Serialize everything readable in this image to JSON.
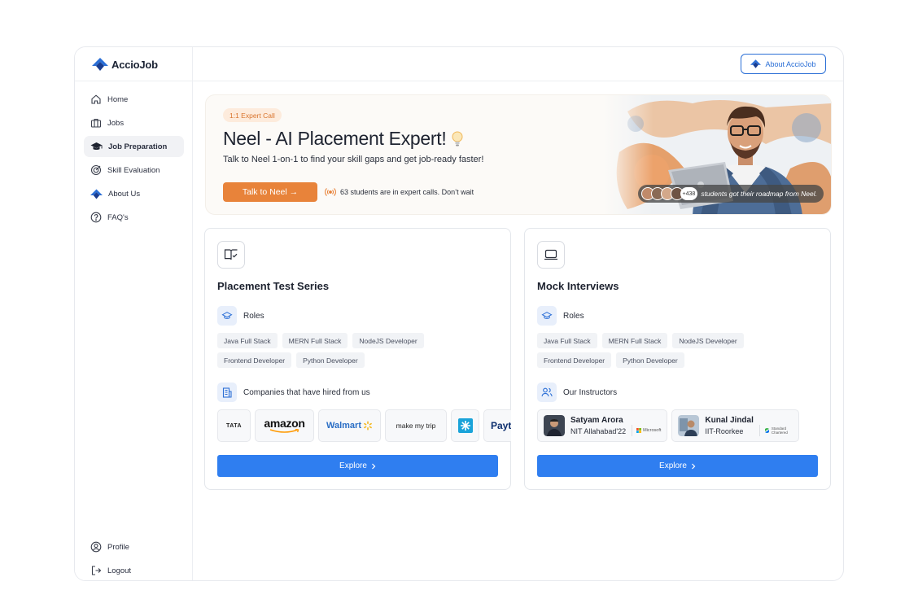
{
  "brand": {
    "name": "AccioJob",
    "color": "#2b6fd6"
  },
  "header": {
    "about_label": "About AccioJob"
  },
  "sidebar": {
    "items": [
      {
        "label": "Home",
        "icon": "home-icon"
      },
      {
        "label": "Jobs",
        "icon": "briefcase-icon"
      },
      {
        "label": "Job Preparation",
        "icon": "graduation-cap-icon",
        "active": true
      },
      {
        "label": "Skill Evaluation",
        "icon": "target-icon"
      },
      {
        "label": "About Us",
        "icon": "acciojob-logo-icon"
      },
      {
        "label": "FAQ's",
        "icon": "question-icon"
      }
    ],
    "bottom": [
      {
        "label": "Profile",
        "icon": "user-circle-icon"
      },
      {
        "label": "Logout",
        "icon": "logout-icon"
      }
    ]
  },
  "hero": {
    "tag": "1:1 Expert Call",
    "title": "Neel - AI Placement Expert!",
    "subtitle": "Talk to Neel 1-on-1 to find your skill gaps and get job-ready faster!",
    "cta": "Talk to Neel →",
    "live_text": "63 students are in expert calls. Don’t wait",
    "avatar_count": "+438",
    "roadmap_text": "students got their roadmap from Neel.",
    "accent": "#e8833a"
  },
  "cards": {
    "placement": {
      "title": "Placement Test Series",
      "roles_label": "Roles",
      "roles": [
        "Java Full Stack",
        "MERN Full Stack",
        "NodeJS Developer",
        "Frontend Developer",
        "Python Developer"
      ],
      "companies_label": "Companies that have hired from us",
      "companies": [
        "TATA",
        "amazon",
        "Walmart",
        "make my trip",
        "Paytm"
      ],
      "explore": "Explore"
    },
    "mock": {
      "title": "Mock Interviews",
      "roles_label": "Roles",
      "roles": [
        "Java Full Stack",
        "MERN Full Stack",
        "NodeJS Developer",
        "Frontend Developer",
        "Python Developer"
      ],
      "instructors_label": "Our Instructors",
      "instructors": [
        {
          "name": "Satyam Arora",
          "college": "NIT Allahabad'22",
          "company": "Microsoft"
        },
        {
          "name": "Kunal Jindal",
          "college": "IIT-Roorkee",
          "company": "Standard Chartered"
        }
      ],
      "explore": "Explore"
    }
  },
  "colors": {
    "primary_button": "#2f7ef0",
    "chip_bg": "#f1f3f6"
  }
}
